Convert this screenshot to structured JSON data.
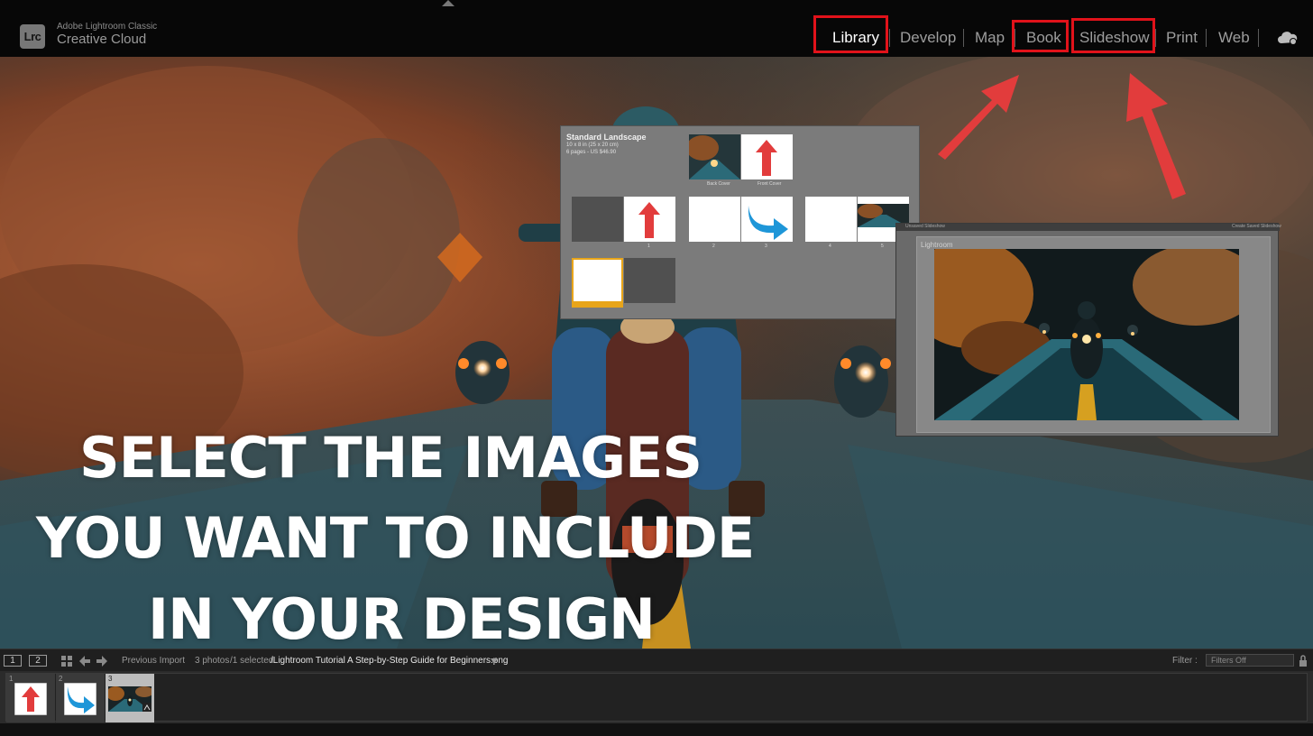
{
  "app": {
    "brand_small": "Adobe Lightroom Classic",
    "brand_large": "Creative Cloud",
    "logo_text": "Lrc"
  },
  "modules": [
    {
      "label": "Library",
      "active": true,
      "highlighted": true
    },
    {
      "label": "Develop",
      "active": false,
      "highlighted": false
    },
    {
      "label": "Map",
      "active": false,
      "highlighted": false
    },
    {
      "label": "Book",
      "active": false,
      "highlighted": true
    },
    {
      "label": "Slideshow",
      "active": false,
      "highlighted": true
    },
    {
      "label": "Print",
      "active": false,
      "highlighted": false
    },
    {
      "label": "Web",
      "active": false,
      "highlighted": false
    }
  ],
  "overlay": {
    "line1": "SELECT THE IMAGES",
    "line2": "YOU WANT TO INCLUDE",
    "line3": "IN YOUR DESIGN"
  },
  "book_panel": {
    "title": "Standard Landscape",
    "size": "10 x 8 in (25 x 20 cm)",
    "price": "6 pages - US $46.90",
    "cover_back_label": "Back Cover",
    "cover_front_label": "Front Cover",
    "page_numbers": [
      "1",
      "2",
      "3",
      "4",
      "5"
    ]
  },
  "slideshow_panel": {
    "header_left": "Unsaved Slideshow",
    "header_right": "Create Saved Slideshow",
    "slide_label": "Lightroom"
  },
  "filmstrip": {
    "view1": "1",
    "view2": "2",
    "source": "Previous Import",
    "count": "3 photos",
    "selected": "/1 selected",
    "filename": "/Lightroom Tutorial A Step-by-Step Guide for Beginners.png",
    "filter_label": "Filter :",
    "filter_value": "Filters Off",
    "cells": [
      {
        "number": "1",
        "content": "red-arrow-up",
        "selected": false
      },
      {
        "number": "2",
        "content": "blue-curved-arrow",
        "selected": false
      },
      {
        "number": "3",
        "content": "motorcycle-photo",
        "selected": true
      }
    ]
  },
  "colors": {
    "highlight_red": "#e1121a",
    "annotation_arrow": "#e23c3c",
    "active_module": "#ffffff",
    "inactive_module": "#9d9d9d"
  },
  "icons": [
    "cloud-sync-icon",
    "grid-view-icon",
    "back-arrow-icon",
    "forward-arrow-icon",
    "dropdown-icon"
  ]
}
